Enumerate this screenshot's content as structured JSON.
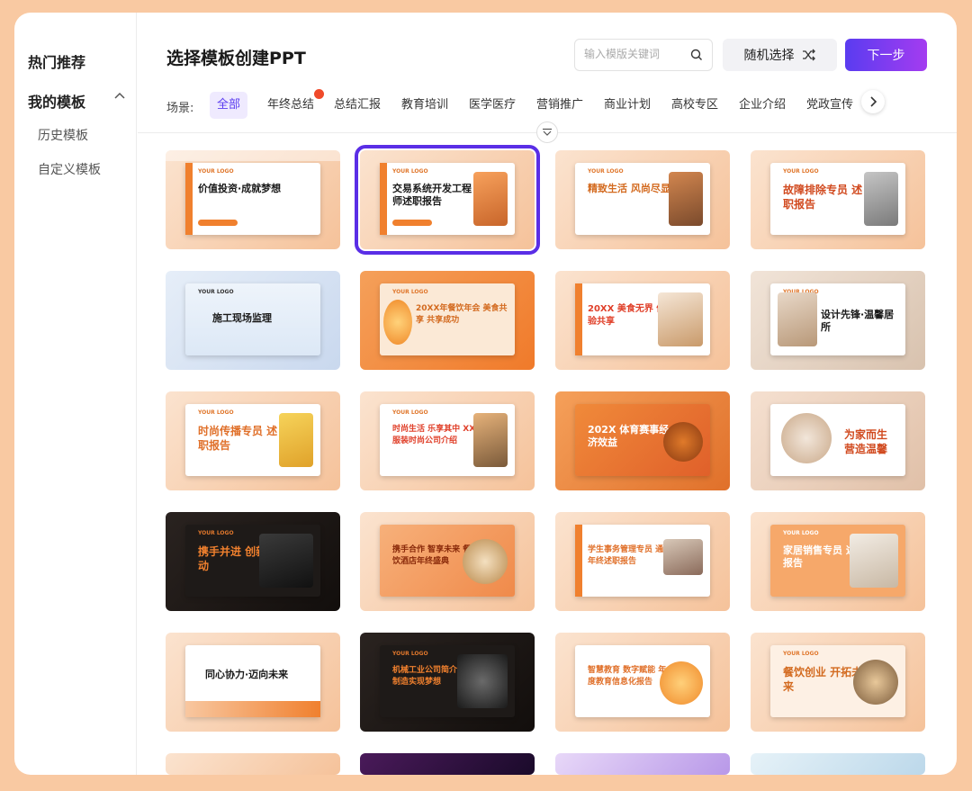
{
  "sidebar": {
    "hot": "热门推荐",
    "mine": "我的模板",
    "history": "历史模板",
    "custom": "自定义模板"
  },
  "header": {
    "title": "选择模板创建PPT",
    "search_placeholder": "输入模版关键词",
    "random_label": "随机选择",
    "next_label": "下一步"
  },
  "categories": {
    "label": "场景:",
    "items": [
      "全部",
      "年终总结",
      "总结汇报",
      "教育培训",
      "医学医疗",
      "营销推广",
      "商业计划",
      "高校专区",
      "企业介绍",
      "党政宣传"
    ]
  },
  "templates": [
    {
      "title": "价值投资·成就梦想",
      "logo": "YOUR LOGO"
    },
    {
      "title": "交易系统开发工程师述职报告",
      "logo": "YOUR LOGO"
    },
    {
      "title": "精致生活 风尚尽显",
      "logo": "YOUR LOGO"
    },
    {
      "title": "故障排除专员 述职报告",
      "logo": "YOUR LOGO"
    },
    {
      "title": "施工现场监理",
      "logo": "YOUR LOGO"
    },
    {
      "title": "20XX年餐饮年会 美食共享 共享成功",
      "logo": "YOUR LOGO"
    },
    {
      "title": "20XX 美食无界 体验共享",
      "logo": ""
    },
    {
      "title": "设计先锋·温馨居所",
      "logo": "YOUR LOGO"
    },
    {
      "title": "时尚传播专员 述职报告",
      "logo": "YOUR LOGO"
    },
    {
      "title": "时尚生活 乐享其中 XX服装时尚公司介绍",
      "logo": "YOUR LOGO"
    },
    {
      "title": "202X 体育赛事经济效益",
      "logo": ""
    },
    {
      "title": "为家而生 营造温馨",
      "logo": ""
    },
    {
      "title": "携手并进 创新驱动",
      "logo": "YOUR LOGO"
    },
    {
      "title": "携手合作 智享未来 餐饮酒店年终盛典",
      "logo": ""
    },
    {
      "title": "学生事务管理专员 通用年终述职报告",
      "logo": ""
    },
    {
      "title": "家居销售专员 述职报告",
      "logo": "YOUR LOGO"
    },
    {
      "title": "同心协力·迈向未来",
      "logo": ""
    },
    {
      "title": "机械工业公司简介 精准制造实现梦想",
      "logo": "YOUR LOGO"
    },
    {
      "title": "智慧教育 数字赋能 年度教育信息化报告",
      "logo": ""
    },
    {
      "title": "餐饮创业 开拓未来",
      "logo": "YOUR LOGO"
    }
  ],
  "colors": {
    "accent": "#5a3cf0",
    "orange": "#f0802e",
    "background": "#f9c9a2"
  }
}
